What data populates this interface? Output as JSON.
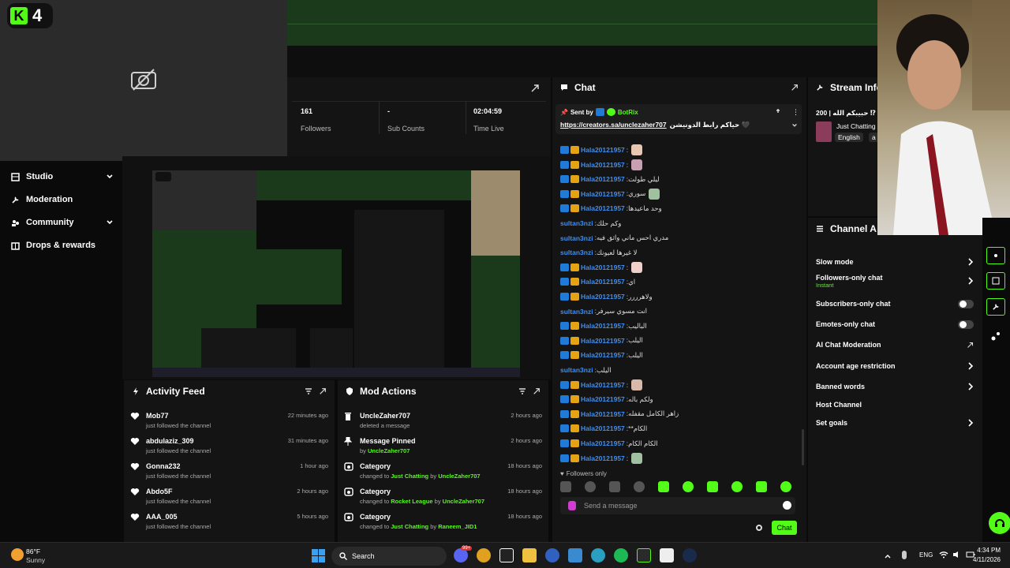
{
  "app": {
    "logo_letter": "K",
    "logo_number": "4"
  },
  "nav": {
    "items": [
      {
        "label": "Studio",
        "icon": "studio-icon",
        "has_chevron": true
      },
      {
        "label": "Moderation",
        "icon": "wrench-icon",
        "has_chevron": false
      },
      {
        "label": "Community",
        "icon": "community-icon",
        "has_chevron": true
      },
      {
        "label": "Drops & rewards",
        "icon": "drops-icon",
        "has_chevron": false
      }
    ]
  },
  "stats": [
    {
      "value": "161",
      "label": "Followers"
    },
    {
      "value": "-",
      "label": "Sub Counts"
    },
    {
      "value": "02:04:59",
      "label": "Time Live"
    }
  ],
  "activity_feed": {
    "title": "Activity Feed",
    "items": [
      {
        "user": "Mob77",
        "action": "just followed the channel",
        "time": "22 minutes ago"
      },
      {
        "user": "abdulaziz_309",
        "action": "just followed the channel",
        "time": "31 minutes ago"
      },
      {
        "user": "Gonna232",
        "action": "just followed the channel",
        "time": "1 hour ago"
      },
      {
        "user": "Abdo5F",
        "action": "just followed the channel",
        "time": "2 hours ago"
      },
      {
        "user": "AAA_005",
        "action": "just followed the channel",
        "time": "5 hours ago"
      }
    ]
  },
  "mod_actions": {
    "title": "Mod Actions",
    "items": [
      {
        "title": "UncleZaher707",
        "prefix": "deleted a message",
        "a": "",
        "mid": "",
        "b": "",
        "time": "2 hours ago",
        "icon": "trash-icon"
      },
      {
        "title": "Message Pinned",
        "prefix": "by ",
        "a": "UncleZaher707",
        "mid": "",
        "b": "",
        "time": "2 hours ago",
        "icon": "pin-icon"
      },
      {
        "title": "Category",
        "prefix": "changed to ",
        "a": "Just Chatting",
        "mid": " by ",
        "b": "UncleZaher707",
        "time": "18 hours ago",
        "icon": "category-icon"
      },
      {
        "title": "Category",
        "prefix": "changed to ",
        "a": "Rocket League",
        "mid": " by ",
        "b": "UncleZaher707",
        "time": "18 hours ago",
        "icon": "category-icon"
      },
      {
        "title": "Category",
        "prefix": "changed to ",
        "a": "Just Chatting",
        "mid": " by ",
        "b": "Raneem_JID1",
        "time": "18 hours ago",
        "icon": "category-icon"
      }
    ]
  },
  "chat": {
    "title": "Chat",
    "pinned_sent_by": "Sent by",
    "pinned_bot": "BotRix",
    "pinned_link": "https://creators.sa/unclezaher707",
    "pinned_text": "حياكم رابط الدونيشن 🖤",
    "messages": [
      {
        "user": "Hala20121957",
        "text": ":",
        "badges": true,
        "emote": true
      },
      {
        "user": "Hala20121957",
        "text": ":",
        "badges": true,
        "emote": true
      },
      {
        "user": "Hala20121957",
        "text": ":ليلي طولت",
        "badges": true,
        "emote": false
      },
      {
        "user": "Hala20121957",
        "text": ":سوري",
        "badges": true,
        "emote": true
      },
      {
        "user": "Hala20121957",
        "text": ":وحد ماعيدها",
        "badges": true,
        "emote": false
      },
      {
        "user": "sultan3nzi",
        "text": ":وكم حلك",
        "badges": false,
        "emote": false
      },
      {
        "user": "sultan3nzi",
        "text": ":مدري احس ماني واثق فيه",
        "badges": false,
        "emote": false
      },
      {
        "user": "sultan3nzi",
        "text": ":لا غيرها لعيونك",
        "badges": false,
        "emote": false
      },
      {
        "user": "Hala20121957",
        "text": ":",
        "badges": true,
        "emote": true
      },
      {
        "user": "Hala20121957",
        "text": ":اي",
        "badges": true,
        "emote": false
      },
      {
        "user": "Hala20121957",
        "text": ":ولاهرررر",
        "badges": true,
        "emote": false
      },
      {
        "user": "sultan3nzi",
        "text": ":انت مسوي سيرفر",
        "badges": false,
        "emote": false
      },
      {
        "user": "Hala20121957",
        "text": ":الباليب",
        "badges": true,
        "emote": false
      },
      {
        "user": "Hala20121957",
        "text": ":اليلب",
        "badges": true,
        "emote": false
      },
      {
        "user": "Hala20121957",
        "text": ":اليلب",
        "badges": true,
        "emote": false
      },
      {
        "user": "sultan3nzi",
        "text": ":اليلب",
        "badges": false,
        "emote": false
      },
      {
        "user": "Hala20121957",
        "text": ":",
        "badges": true,
        "emote": true
      },
      {
        "user": "Hala20121957",
        "text": ":ولكم باله",
        "badges": true,
        "emote": false
      },
      {
        "user": "Hala20121957",
        "text": ":زاهر الكامل مقفله",
        "badges": true,
        "emote": false
      },
      {
        "user": "Hala20121957",
        "text": ":**الكام",
        "badges": true,
        "emote": false
      },
      {
        "user": "Hala20121957",
        "text": ":الكام الكام",
        "badges": true,
        "emote": false
      },
      {
        "user": "Hala20121957",
        "text": ":",
        "badges": true,
        "emote": true
      }
    ],
    "followers_only": "Followers only",
    "input_placeholder": "Send a message",
    "send_label": "Chat"
  },
  "stream_info": {
    "title": "Stream Info",
    "stream_title": "حبيبكم الله | 200 ⁉",
    "category": "Just Chatting",
    "tag1": "English",
    "tag2": "a"
  },
  "channel_actions": {
    "title": "Channel A",
    "items": [
      {
        "label": "Slow mode",
        "sub": "",
        "control": "chevron"
      },
      {
        "label": "Followers-only chat",
        "sub": "Instant",
        "control": "chevron"
      },
      {
        "label": "Subscribers-only chat",
        "sub": "",
        "control": "toggle"
      },
      {
        "label": "Emotes-only chat",
        "sub": "",
        "control": "toggle"
      },
      {
        "label": "AI Chat Moderation",
        "sub": "",
        "control": "external"
      },
      {
        "label": "Account age restriction",
        "sub": "",
        "control": "chevron"
      },
      {
        "label": "Banned words",
        "sub": "",
        "control": "chevron"
      },
      {
        "label": "Host Channel",
        "sub": "",
        "control": "none"
      },
      {
        "label": "Set goals",
        "sub": "",
        "control": "chevron"
      }
    ]
  },
  "taskbar": {
    "weather_temp": "86°F",
    "weather_cond": "Sunny",
    "search_label": "Search",
    "language": "ENG",
    "time": "4:34 PM",
    "date": "4/11/2026",
    "discord_badge": "99+"
  },
  "colors": {
    "accent": "#53fc18",
    "username": "#3f8ef0",
    "panel": "#141414"
  }
}
